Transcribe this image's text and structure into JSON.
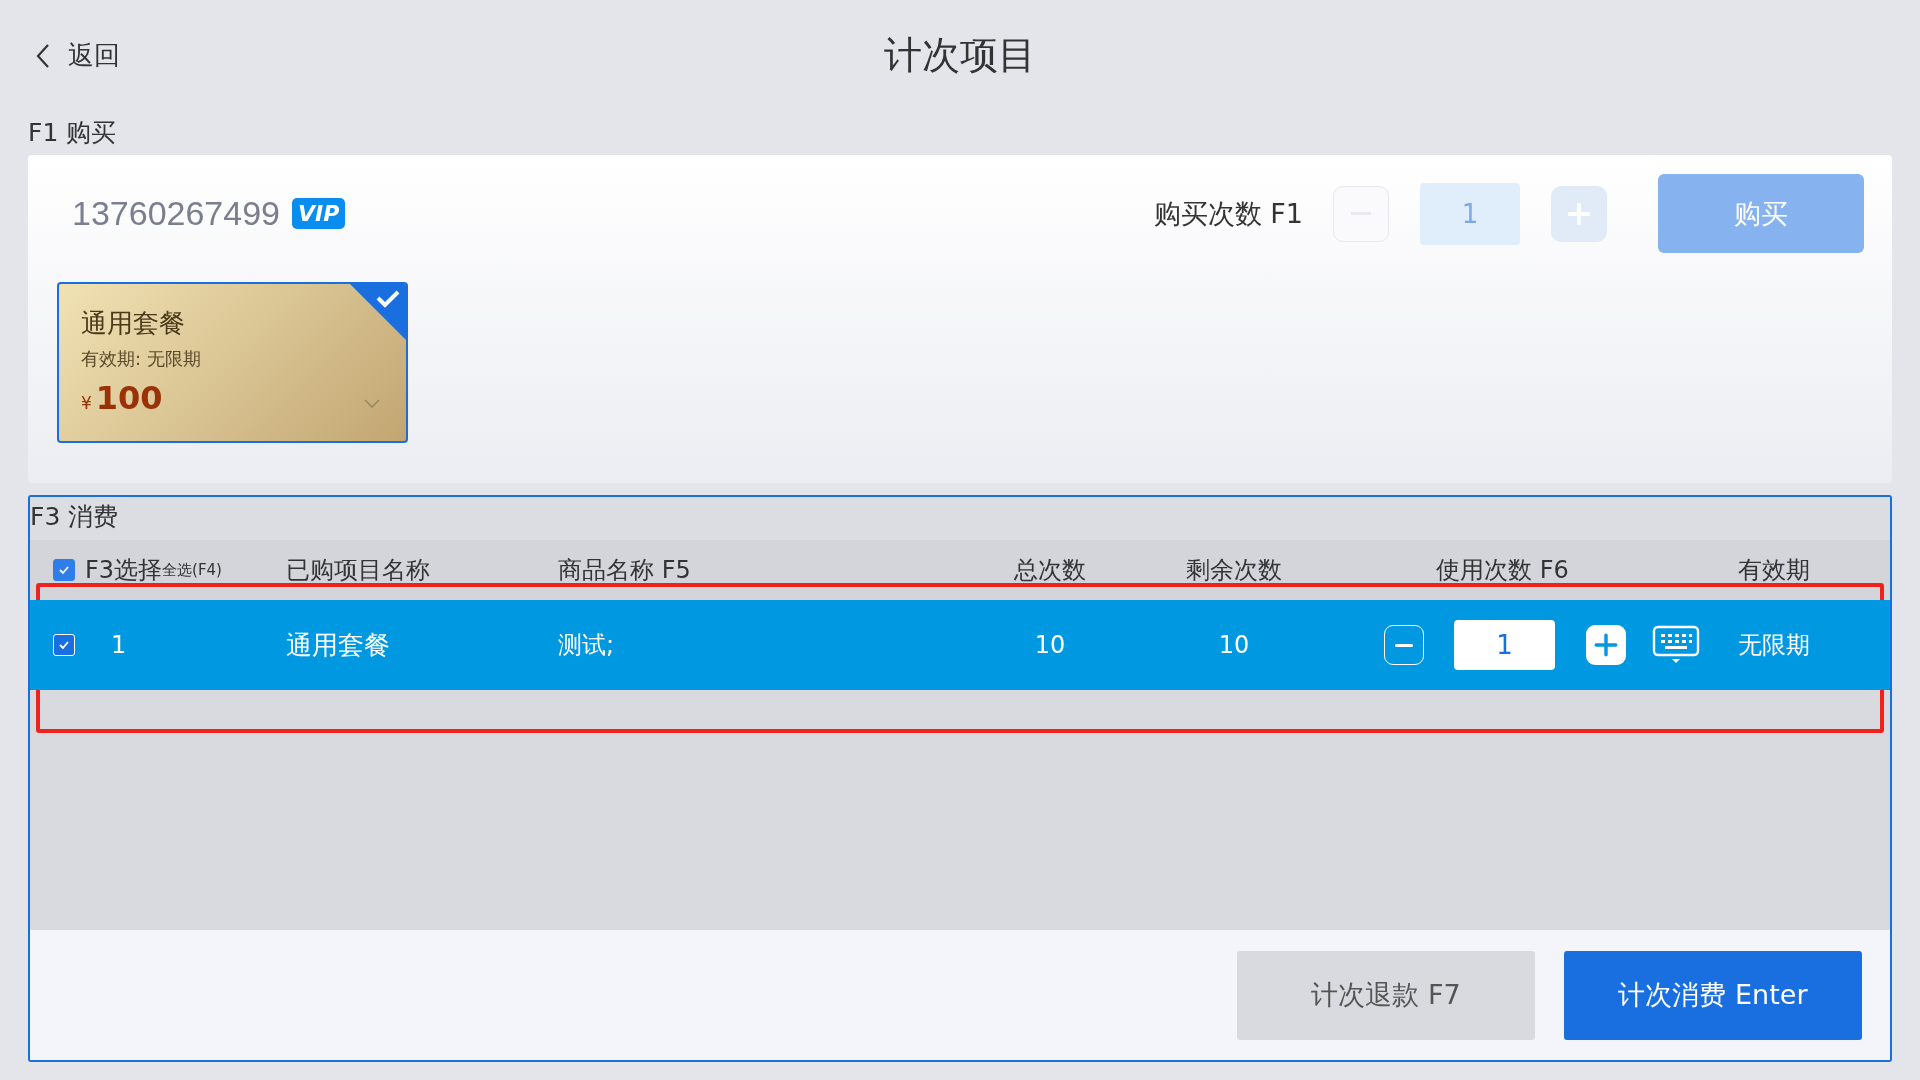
{
  "header": {
    "back_label": "返回",
    "title": "计次项目"
  },
  "purchase": {
    "section_label": "F1 购买",
    "phone": "13760267499",
    "badge": "VIP",
    "quantity_label": "购买次数 F1",
    "quantity": "1",
    "stepper_disabled": true,
    "buy_button": {
      "label": "购买",
      "disabled": true
    },
    "packages": [
      {
        "name": "通用套餐",
        "validity": "有效期: 无限期",
        "currency": "¥",
        "price": "100",
        "selected": true
      }
    ]
  },
  "consume": {
    "section_label": "F3 消费",
    "select_all": {
      "label": "F3选择",
      "hint": "全选(F4)",
      "checked": true
    },
    "columns": [
      "已购项目名称",
      "商品名称 F5",
      "总次数",
      "剩余次数",
      "使用次数 F6",
      "有效期"
    ],
    "rows": [
      {
        "index": "1",
        "checked": true,
        "selected": true,
        "highlighted": true,
        "name": "通用套餐",
        "product": "测试;",
        "total": "10",
        "remaining": "10",
        "use_count": "1",
        "validity": "无限期"
      }
    ],
    "buttons": [
      {
        "label": "计次退款 F7",
        "kind": "secondary"
      },
      {
        "label": "计次消费 Enter",
        "kind": "primary"
      }
    ]
  }
}
